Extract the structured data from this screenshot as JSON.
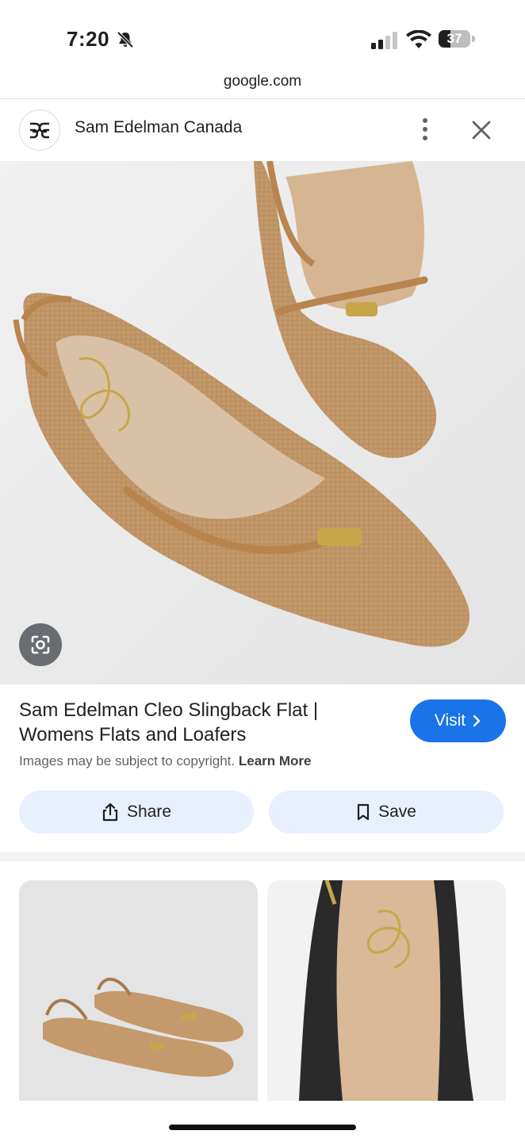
{
  "status_bar": {
    "time": "7:20",
    "battery": "37",
    "battery_level": 0.37
  },
  "browser": {
    "url": "google.com"
  },
  "header": {
    "site_name": "Sam Edelman Canada",
    "logo_icon": "sam-edelman-logo"
  },
  "result": {
    "title": "Sam Edelman Cleo Slingback Flat | Womens Flats and Loafers",
    "visit_label": "Visit",
    "copyright_text": "Images may be subject to copyright.",
    "learn_more_label": "Learn More",
    "share_label": "Share",
    "save_label": "Save"
  },
  "colors": {
    "accent": "#1a73e8",
    "pill_bg": "#e8f0fe",
    "shoe_tan": "#c09266"
  }
}
